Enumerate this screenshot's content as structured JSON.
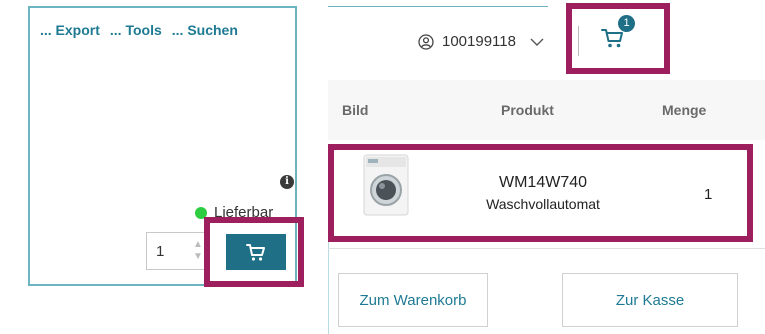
{
  "left_panel": {
    "tools": {
      "export_label": "... Export",
      "tools_label": "... Tools",
      "search_label": "... Suchen"
    },
    "info_icon_glyph": "i",
    "availability": {
      "label": "Lieferbar",
      "status_color": "#2ecc40"
    },
    "quantity": {
      "value": "1"
    },
    "add_to_cart_icon": "cart-icon"
  },
  "header": {
    "account_number": "100199118",
    "cart_badge_count": "1",
    "cart_icon": "cart-icon"
  },
  "table": {
    "headers": {
      "image": "Bild",
      "product": "Produkt",
      "quantity": "Menge"
    },
    "rows": [
      {
        "model": "WM14W740",
        "description": "Waschvollautomat",
        "quantity": "1"
      }
    ]
  },
  "actions": {
    "to_cart_label": "Zum Warenkorb",
    "checkout_label": "Zur Kasse"
  },
  "colors": {
    "accent": "#1f6f87",
    "link": "#1e7a93",
    "highlight": "#9e1f5e",
    "panel_border": "#6cb5c0"
  }
}
